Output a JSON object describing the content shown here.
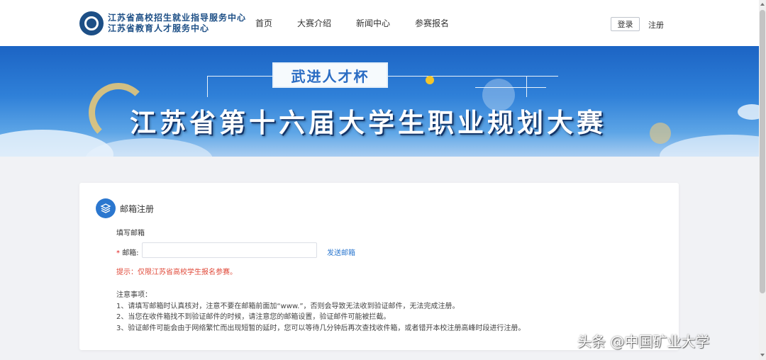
{
  "header": {
    "logo": {
      "line1": "江苏省高校招生就业指导服务中心",
      "line2": "江苏省教育人才服务中心"
    },
    "nav": [
      {
        "label": "首页"
      },
      {
        "label": "大赛介绍"
      },
      {
        "label": "新闻中心"
      },
      {
        "label": "参赛报名"
      }
    ],
    "login_label": "登录",
    "register_label": "注册"
  },
  "banner": {
    "cup": "武进人才杯",
    "title": "江苏省第十六届大学生职业规划大赛"
  },
  "card": {
    "title": "邮箱注册",
    "section_label": "填写邮箱",
    "required_mark": "*",
    "email_label": "邮箱:",
    "email_value": "",
    "send_link": "发送邮箱",
    "hint": "提示：仅限江苏省高校学生报名参赛。",
    "notes_title": "注意事项：",
    "notes": [
      "1、请填写邮箱时认真核对，注意不要在邮箱前面加“www.”，否则会导致无法收到验证邮件，无法完成注册。",
      "2、当您在收件箱找不到验证邮件的时候，请注意您的邮箱设置，验证邮件可能被拦截。",
      "3、验证邮件可能会由于网络繁忙而出现短暂的延时，您可以等待几分钟后再次查找收件箱，或者错开本校注册高峰时段进行注册。"
    ]
  },
  "watermark": "头条 @中国矿业大学",
  "colors": {
    "accent": "#2b77cf",
    "hint_red": "#e04a3a",
    "banner_blue": "#1c64c4"
  }
}
